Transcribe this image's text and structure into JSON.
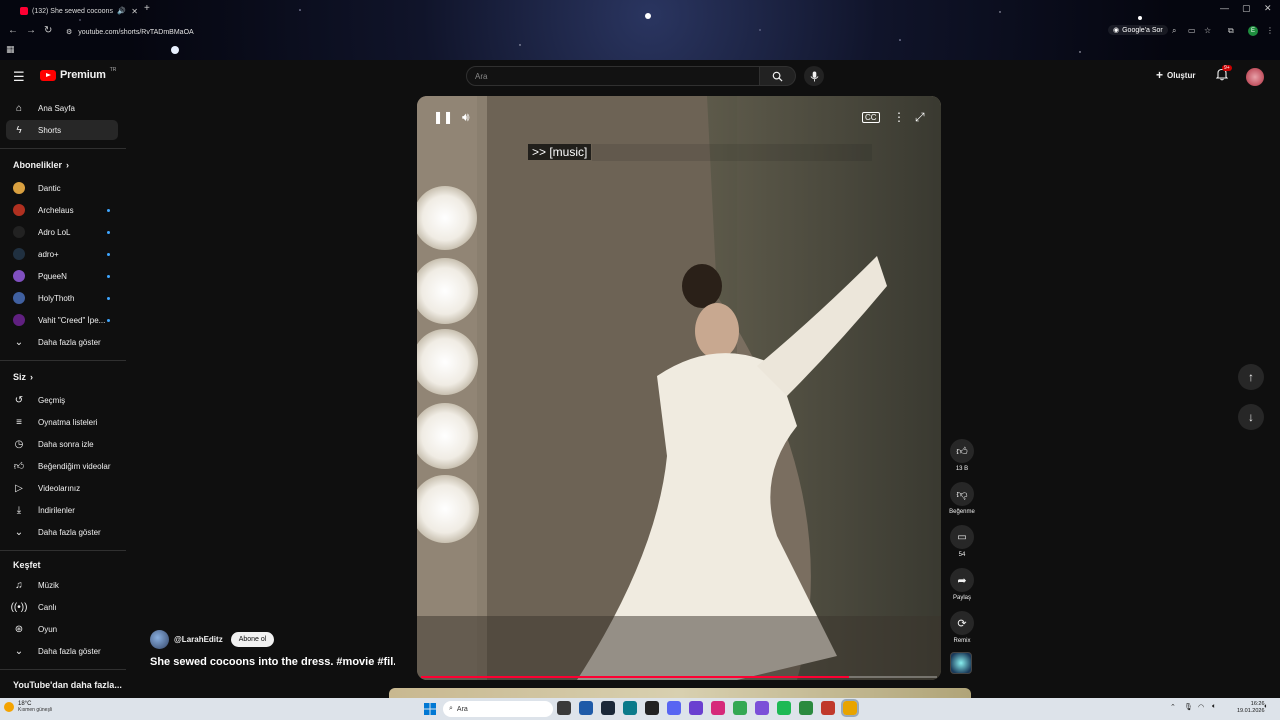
{
  "browser": {
    "tab_title": "(132) She sewed cocoons",
    "url": "youtube.com/shorts/RvTADmBMaOA",
    "ask_google": "Google'a Sor",
    "profile_initial": "E"
  },
  "header": {
    "logo_text": "Premium",
    "logo_region": "TR",
    "search_placeholder": "Ara",
    "create_label": "Oluştur",
    "notif_badge": "9+"
  },
  "sidebar": {
    "home": "Ana Sayfa",
    "shorts": "Shorts",
    "subs_header": "Abonelikler",
    "channels": [
      {
        "name": "Dantic",
        "color": "#d9a040",
        "new": false
      },
      {
        "name": "Archelaus",
        "color": "#b03020",
        "new": true
      },
      {
        "name": "Adro LoL",
        "color": "#222222",
        "new": true
      },
      {
        "name": "adro+",
        "color": "#203040",
        "new": true
      },
      {
        "name": "PqueeN",
        "color": "#8050c0",
        "new": true
      },
      {
        "name": "HolyThoth",
        "color": "#4060a0",
        "new": true
      },
      {
        "name": "Vahit \"Creed\" İpe...",
        "color": "#602080",
        "new": true
      }
    ],
    "show_more": "Daha fazla göster",
    "you_header": "Siz",
    "you_items": [
      "Geçmiş",
      "Oynatma listeleri",
      "Daha sonra izle",
      "Beğendiğim videolar",
      "Videolarınız",
      "İndirilenler"
    ],
    "explore_header": "Keşfet",
    "explore_items": [
      "Müzik",
      "Canlı",
      "Oyun"
    ],
    "more_from": "YouTube'dan daha fazla..."
  },
  "video": {
    "caption": ">> [music]",
    "progress_fraction": 0.83,
    "channel_handle": "@LarahEditz",
    "subscribe_label": "Abone ol",
    "title": "She sewed cocoons into the dress. #movie #fil..."
  },
  "actions": {
    "like_count": "13 B",
    "dislike_label": "Beğenme",
    "comment_count": "54",
    "share_label": "Paylaş",
    "remix_label": "Remix"
  },
  "taskbar": {
    "temp": "18°C",
    "weather": "Kısmen güneşli",
    "search": "Ara",
    "time": "16:26",
    "date": "19.01.2026"
  }
}
